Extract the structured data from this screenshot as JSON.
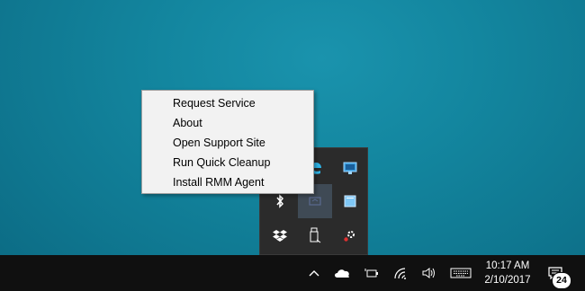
{
  "context_menu": {
    "items": [
      {
        "label": "Request Service"
      },
      {
        "label": "About"
      },
      {
        "label": "Open Support Site"
      },
      {
        "label": "Run Quick Cleanup"
      },
      {
        "label": "Install RMM Agent"
      }
    ]
  },
  "tray_overflow": {
    "icons": [
      "edge-icon",
      "network-monitor-icon",
      "bluetooth-icon",
      "agent-app-icon",
      "notepad-icon",
      "dropbox-icon",
      "usb-drive-icon",
      "settings-gear-icon"
    ]
  },
  "taskbar": {
    "clock": {
      "time": "10:17 AM",
      "date": "2/10/2017"
    },
    "notification_count": "24",
    "tray_icons": [
      "chevron-up-icon",
      "onedrive-icon",
      "battery-icon",
      "wifi-icon",
      "volume-icon",
      "keyboard-icon",
      "action-center-icon"
    ]
  },
  "colors": {
    "desktop": "#13869f",
    "taskbar": "#101010",
    "menu_bg": "#f2f2f2",
    "flyout_bg": "#2b2b2b"
  }
}
